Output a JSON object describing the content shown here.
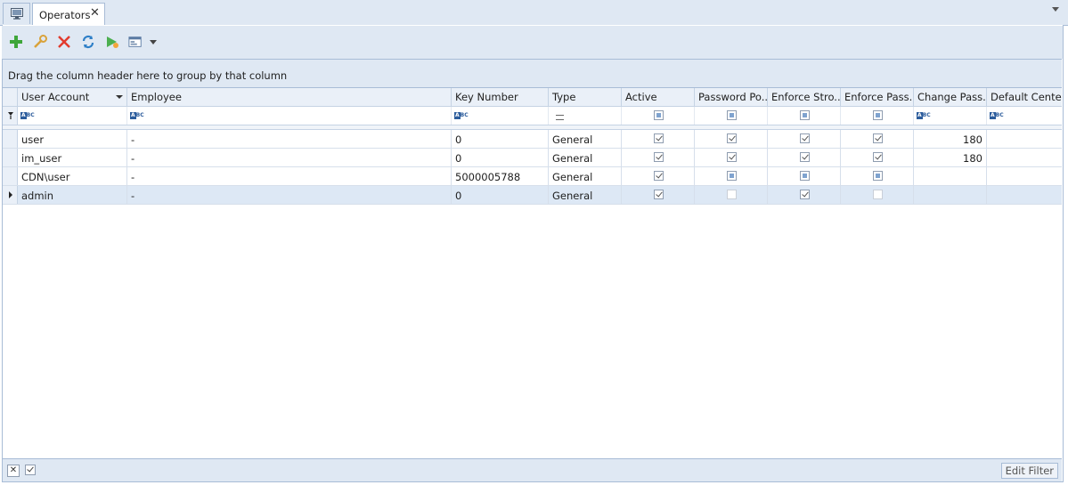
{
  "tabs": {
    "home_icon": "monitor-icon",
    "active_label": "Operators",
    "close_glyph": "✕"
  },
  "toolbar": {
    "buttons": [
      "add-icon",
      "edit-wrench-icon",
      "delete-icon",
      "refresh-icon",
      "run-icon",
      "view-settings-icon"
    ]
  },
  "group_panel": {
    "text": "Drag the column header here to group by that column"
  },
  "columns": [
    {
      "label": "User Account"
    },
    {
      "label": "Employee"
    },
    {
      "label": "Key Number"
    },
    {
      "label": "Type"
    },
    {
      "label": "Active"
    },
    {
      "label": "Password Po..."
    },
    {
      "label": "Enforce Stro..."
    },
    {
      "label": "Enforce Pass..."
    },
    {
      "label": "Change Pass..."
    },
    {
      "label": "Default Center"
    }
  ],
  "rows": [
    {
      "account": "user",
      "employee": "-",
      "key": "0",
      "type": "General",
      "active": true,
      "pwd_policy": true,
      "enforce_strong": true,
      "enforce_pass": true,
      "change_pass": "180",
      "default_center": ""
    },
    {
      "account": "im_user",
      "employee": "-",
      "key": "0",
      "type": "General",
      "active": true,
      "pwd_policy": true,
      "enforce_strong": true,
      "enforce_pass": true,
      "change_pass": "180",
      "default_center": ""
    },
    {
      "account": "CDN\\user",
      "employee": "-",
      "key": "5000005788",
      "type": "General",
      "active": true,
      "pwd_policy": "indeterminate",
      "enforce_strong": "indeterminate",
      "enforce_pass": "indeterminate",
      "change_pass": "",
      "default_center": ""
    },
    {
      "account": "admin",
      "employee": "-",
      "key": "0",
      "type": "General",
      "active": true,
      "pwd_policy": false,
      "enforce_strong": true,
      "enforce_pass": false,
      "change_pass": "",
      "default_center": "",
      "selected": true
    }
  ],
  "footer": {
    "edit_filter_label": "Edit Filter"
  }
}
